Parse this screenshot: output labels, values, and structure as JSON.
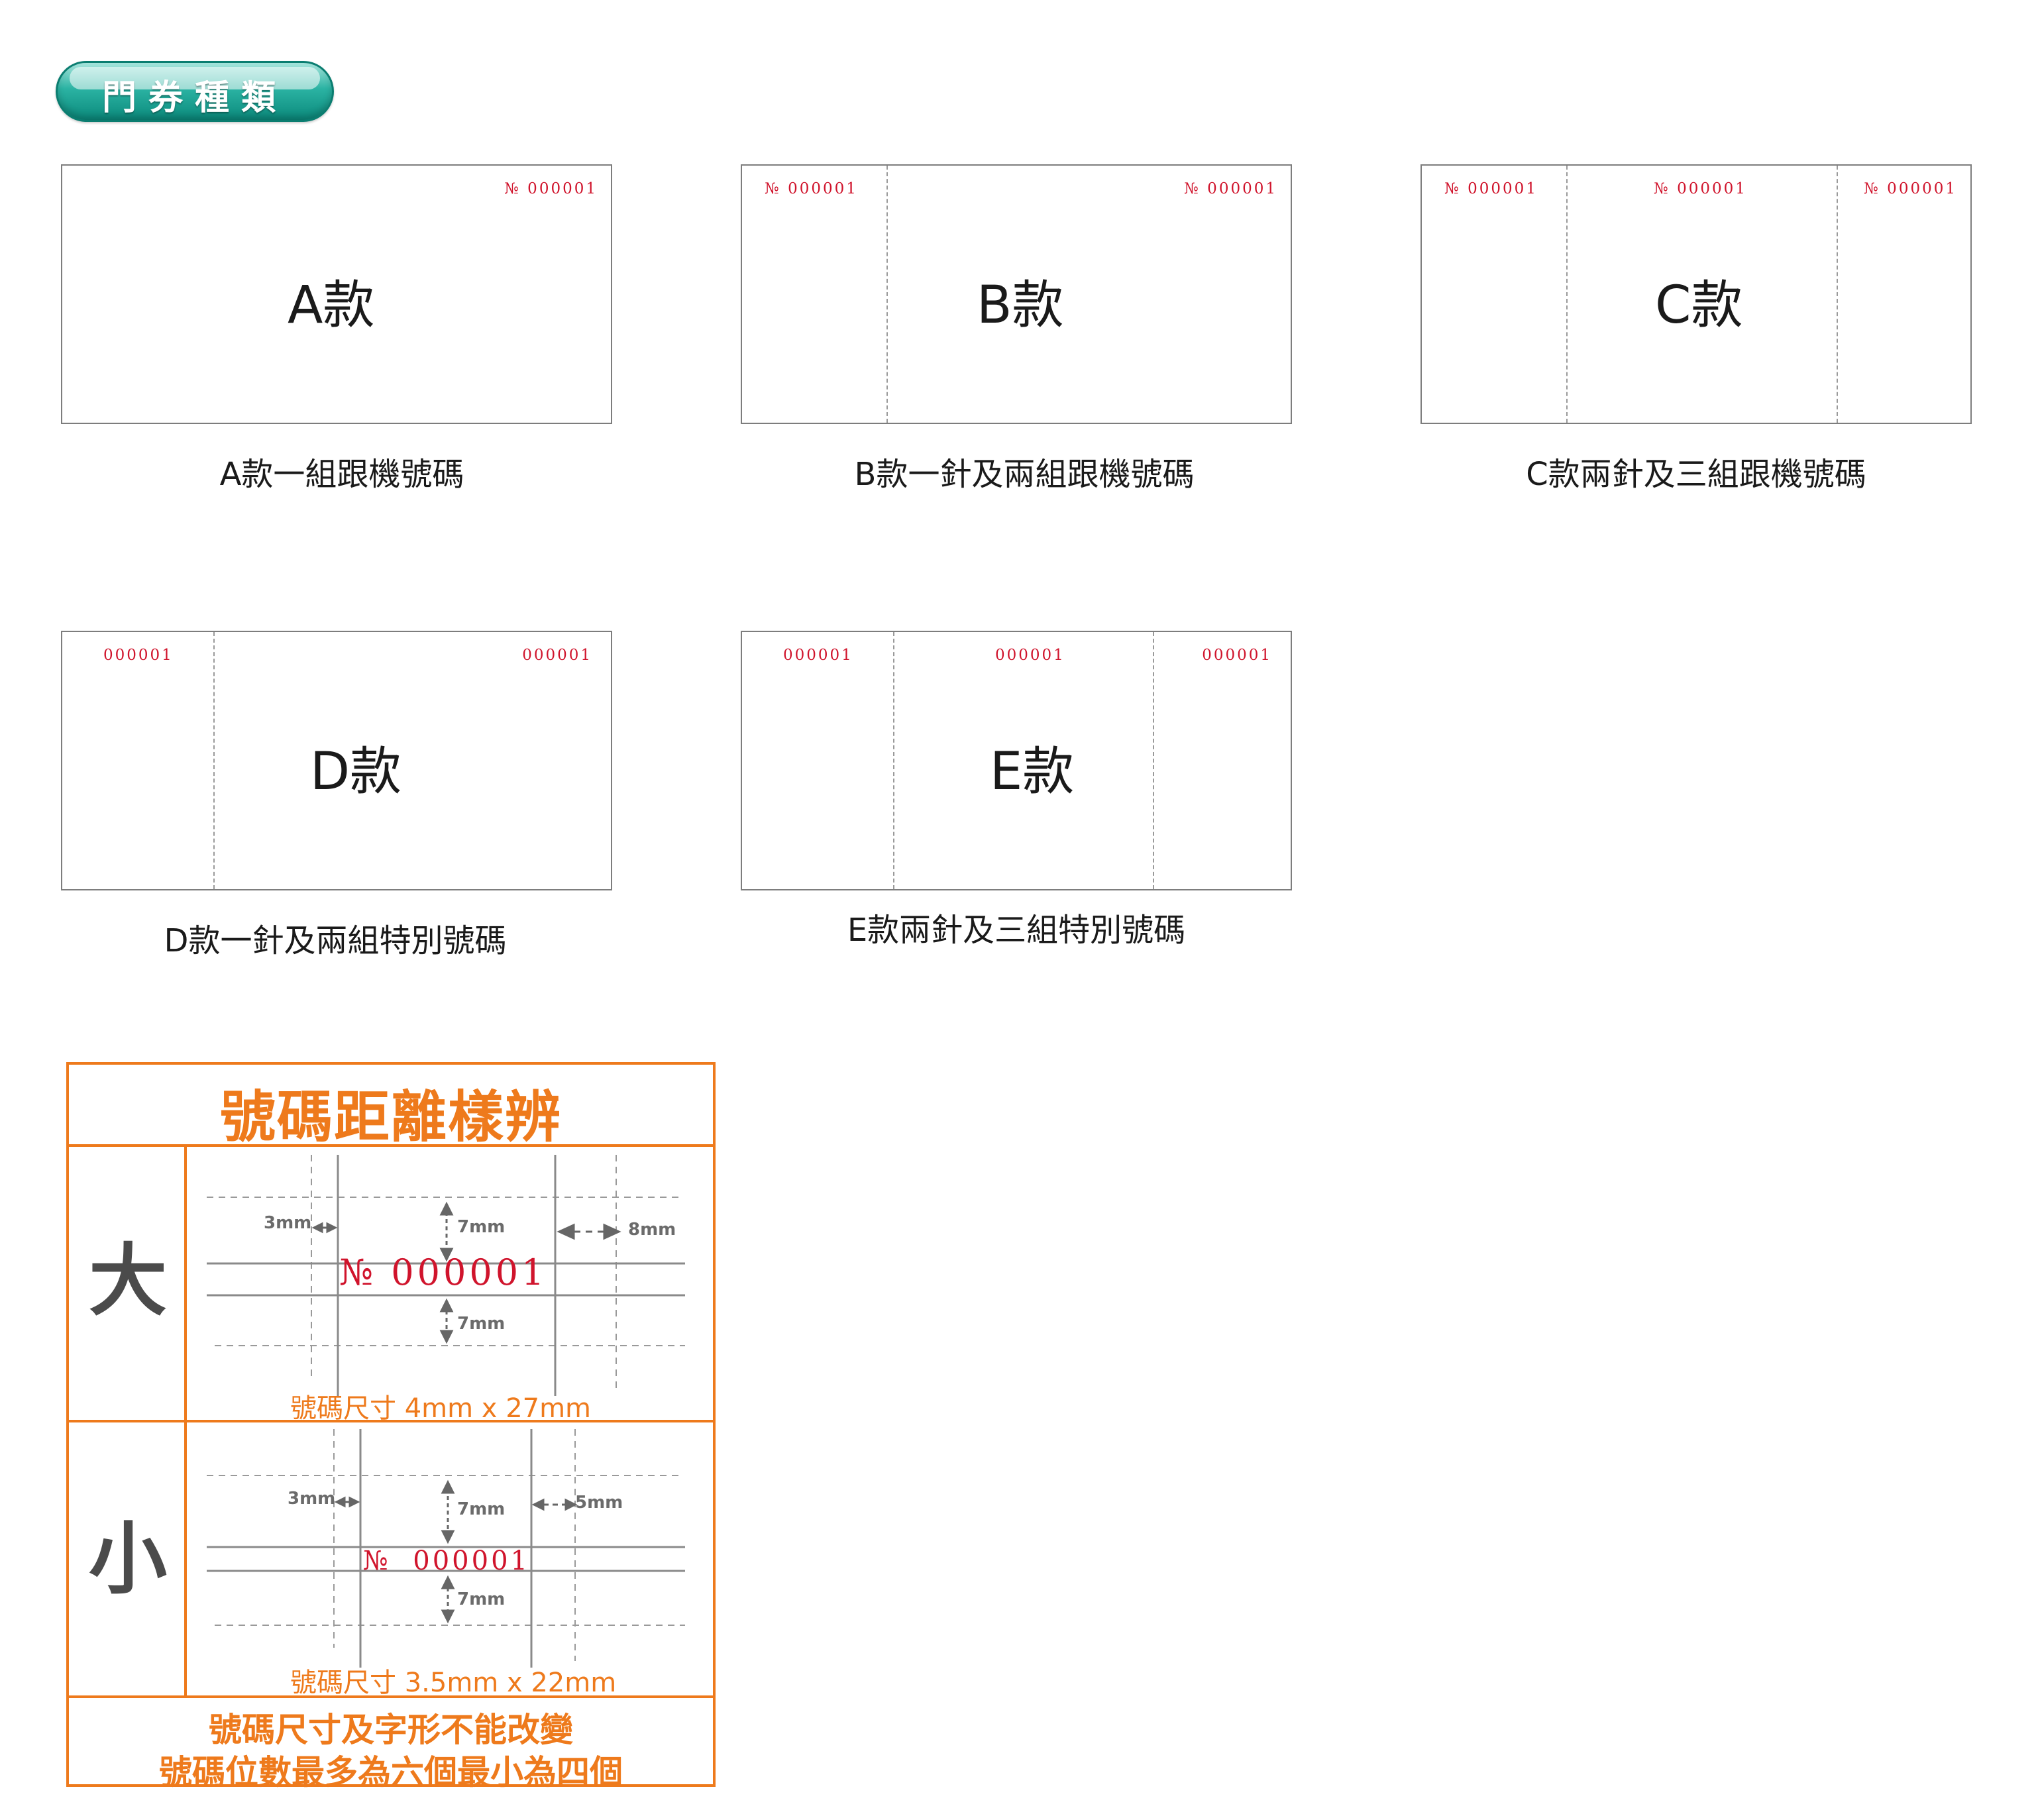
{
  "header": {
    "title": "門券種類"
  },
  "tickets": [
    {
      "label": "A款",
      "caption": "A款一組跟機號碼",
      "numbers": [
        "№ 000001"
      ]
    },
    {
      "label": "B款",
      "caption": "B款一針及兩組跟機號碼",
      "numbers": [
        "№ 000001",
        "№ 000001"
      ]
    },
    {
      "label": "C款",
      "caption": "C款兩針及三組跟機號碼",
      "numbers": [
        "№ 000001",
        "№ 000001",
        "№ 000001"
      ]
    },
    {
      "label": "D款",
      "caption": "D款一針及兩組特別號碼",
      "numbers": [
        "000001",
        "000001"
      ]
    },
    {
      "label": "E款",
      "caption": "E款兩針及三組特別號碼",
      "numbers": [
        "000001",
        "000001",
        "000001"
      ]
    }
  ],
  "spacing": {
    "title": "號碼距離樣辨",
    "large": {
      "label": "大",
      "number": "№ 000001",
      "left_gap": "3mm",
      "top_gap": "7mm",
      "bottom_gap": "7mm",
      "right_gap": "8mm",
      "size_caption": "號碼尺寸 4mm x 27mm"
    },
    "small": {
      "label": "小",
      "number": "№  000001",
      "left_gap": "3mm",
      "top_gap": "7mm",
      "bottom_gap": "7mm",
      "right_gap": "5mm",
      "size_caption": "號碼尺寸 3.5mm x 22mm"
    },
    "notes": [
      "號碼尺寸及字形不能改變",
      "號碼位數最多為六個最小為四個"
    ]
  },
  "colors": {
    "accent": "#ee7a1c",
    "number_red": "#d0142c",
    "teal": "#1aa394"
  }
}
